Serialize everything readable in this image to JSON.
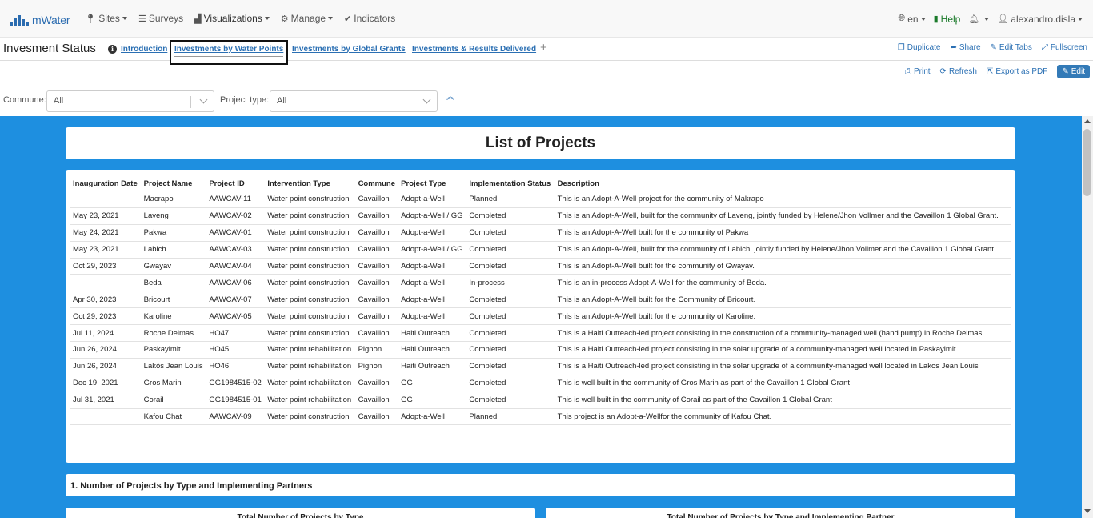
{
  "brand": {
    "name": "mWater"
  },
  "nav": {
    "items": [
      {
        "label": "Sites",
        "icon": "map-marker-icon",
        "dropdown": true
      },
      {
        "label": "Surveys",
        "icon": "list-icon",
        "dropdown": false
      },
      {
        "label": "Visualizations",
        "icon": "bar-chart-icon",
        "dropdown": true
      },
      {
        "label": "Manage",
        "icon": "gear-icon",
        "dropdown": true
      },
      {
        "label": "Indicators",
        "icon": "check-circle-icon",
        "dropdown": false
      }
    ],
    "language": "en",
    "help": "Help",
    "user": "alexandro.disla"
  },
  "dashboard": {
    "title": "Invesment Status",
    "tabs": [
      "Introduction",
      "Investments by Water Points",
      "Investments by Global Grants",
      "Investments & Results Delivered"
    ],
    "selected_tab": "Investments by Water Points",
    "actions": {
      "duplicate": "Duplicate",
      "share": "Share",
      "edit_tabs": "Edit Tabs",
      "fullscreen": "Fullscreen"
    },
    "toolbar": {
      "print": "Print",
      "refresh": "Refresh",
      "export_pdf": "Export as PDF",
      "edit": "Edit"
    }
  },
  "filters": {
    "commune": {
      "label": "Commune:",
      "value": "All"
    },
    "project_type": {
      "label": "Project type:",
      "value": "All"
    }
  },
  "content": {
    "list_title": "List of Projects",
    "table": {
      "headers": [
        "Inauguration Date",
        "Project Name",
        "Project ID",
        "Intervention Type",
        "Commune",
        "Project Type",
        "Implementation Status",
        "Description"
      ],
      "rows": [
        [
          "",
          "Macrapo",
          "AAWCAV-11",
          "Water point construction",
          "Cavaillon",
          "Adopt-a-Well",
          "Planned",
          "This is an Adopt-A-Well project for the community of Makrapo"
        ],
        [
          "May 23, 2021",
          "Laveng",
          "AAWCAV-02",
          "Water point construction",
          "Cavaillon",
          "Adopt-a-Well / GG",
          "Completed",
          "This is an Adopt-A-Well, built for the community of Laveng, jointly funded by Helene/Jhon Vollmer and the Cavaillon 1 Global Grant."
        ],
        [
          "May 24, 2021",
          "Pakwa",
          "AAWCAV-01",
          "Water point construction",
          "Cavaillon",
          "Adopt-a-Well",
          "Completed",
          "This is an Adopt-A-Well built for the community of Pakwa"
        ],
        [
          "May 23, 2021",
          "Labich",
          "AAWCAV-03",
          "Water point construction",
          "Cavaillon",
          "Adopt-a-Well / GG",
          "Completed",
          "This is an Adopt-A-Well, built for the community of Labich, jointly funded by Helene/Jhon Vollmer and the Cavaillon 1 Global Grant."
        ],
        [
          "Oct 29, 2023",
          "Gwayav",
          "AAWCAV-04",
          "Water point construction",
          "Cavaillon",
          "Adopt-a-Well",
          "Completed",
          "This is an Adopt-A-Well built for the community of Gwayav."
        ],
        [
          "",
          "Beda",
          "AAWCAV-06",
          "Water point construction",
          "Cavaillon",
          "Adopt-a-Well",
          "In-process",
          "This is an in-process Adopt-A-Well for the community of Beda."
        ],
        [
          "Apr 30, 2023",
          "Bricourt",
          "AAWCAV-07",
          "Water point construction",
          "Cavaillon",
          "Adopt-a-Well",
          "Completed",
          "This is an Adopt-A-Well built for the Community of Bricourt."
        ],
        [
          "Oct 29, 2023",
          "Karoline",
          "AAWCAV-05",
          "Water point construction",
          "Cavaillon",
          "Adopt-a-Well",
          "Completed",
          "This is an Adopt-A-Well built for the community of Karoline."
        ],
        [
          "Jul 11, 2024",
          "Roche Delmas",
          "HO47",
          "Water point construction",
          "Cavaillon",
          "Haiti Outreach",
          "Completed",
          "This is a Haiti Outreach-led project consisting in the construction of a community-managed well (hand pump) in Roche Delmas."
        ],
        [
          "Jun 26, 2024",
          "Paskayimit",
          "HO45",
          "Water point rehabilitation",
          "Pignon",
          "Haiti Outreach",
          "Completed",
          "This is a Haiti Outreach-led project consisting in the solar upgrade of a community-managed well located in Paskayimit"
        ],
        [
          "Jun 26, 2024",
          "Lakòs Jean Louis",
          "HO46",
          "Water point rehabilitation",
          "Pignon",
          "Haiti Outreach",
          "Completed",
          "This is a Haiti Outreach-led project consisting in the solar upgrade of a community-managed well located in Lakos Jean Louis"
        ],
        [
          "Dec 19, 2021",
          "Gros Marin",
          "GG1984515-02",
          "Water point rehabilitation",
          "Cavaillon",
          "GG",
          "Completed",
          "This is well built in the community of Gros Marin as part of the Cavaillon 1 Global Grant"
        ],
        [
          "Jul 31, 2021",
          "Corail",
          "GG1984515-01",
          "Water point rehabilitation",
          "Cavaillon",
          "GG",
          "Completed",
          "This is well built in the community of Corail as part of the Cavaillon 1 Global Grant"
        ],
        [
          "",
          "Kafou Chat",
          "AAWCAV-09",
          "Water point construction",
          "Cavaillon",
          "Adopt-a-Well",
          "Planned",
          "This project is an Adopt-a-Wellfor the community of Kafou Chat."
        ]
      ]
    },
    "section1_title": "1. Number of Projects by Type and Implementing Partners",
    "chart1_title": "Total Number of  Projects by Type",
    "chart2_title": "Total Number of Projects by Type and Implementing Partner"
  },
  "colors": {
    "dashboard_bg": "#1e8fe0",
    "link": "#2a6fb3",
    "brand": "#2b6cb0",
    "edit_button": "#337ab7"
  }
}
